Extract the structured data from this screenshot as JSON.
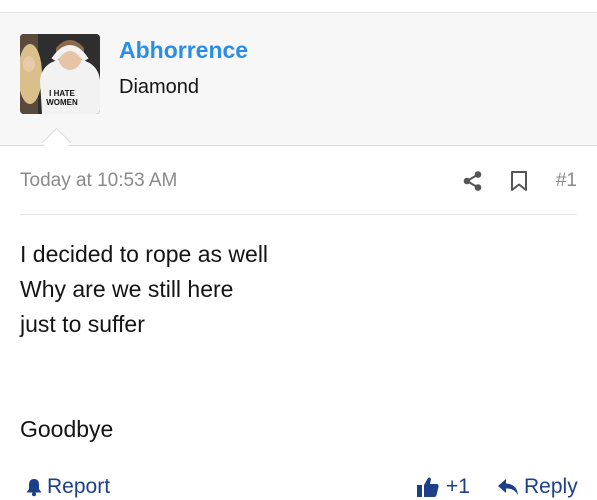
{
  "user": {
    "name": "Abhorrence",
    "title": "Diamond",
    "avatar_caption_line1": "I HATE",
    "avatar_caption_line2": "WOMEN"
  },
  "post": {
    "date": "Today at 10:53 AM",
    "number": "#1",
    "lines": [
      "I decided to rope as well",
      "Why are we still here",
      "just to suffer",
      "Goodbye"
    ]
  },
  "actions": {
    "report": "Report",
    "like": "+1",
    "reply": "Reply"
  },
  "icons": {
    "share": "share-icon",
    "bookmark": "bookmark-icon",
    "report": "bell-icon",
    "like": "thumbs-up-icon",
    "reply": "reply-arrow-icon"
  },
  "colors": {
    "username": "#2a8fe4",
    "action": "#1d3f8a",
    "meta": "#8a8a8a"
  }
}
